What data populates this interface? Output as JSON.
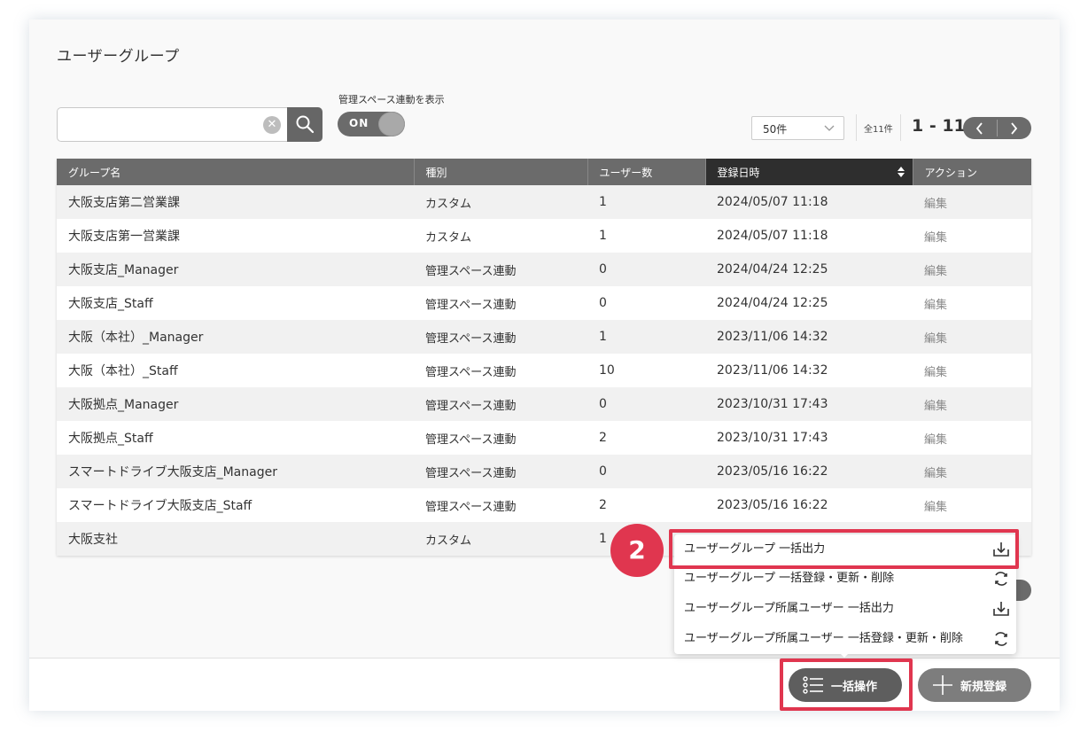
{
  "page": {
    "title": "ユーザーグループ"
  },
  "search": {
    "value": "",
    "placeholder": ""
  },
  "toggle": {
    "label": "管理スペース連動を表示",
    "state": "ON"
  },
  "pagination": {
    "per_page": "50件",
    "total": "全11件",
    "range": "1 - 11"
  },
  "table": {
    "columns": [
      "グループ名",
      "種別",
      "ユーザー数",
      "登録日時",
      "アクション"
    ],
    "rows": [
      {
        "name": "大阪支店第二営業課",
        "type": "カスタム",
        "users": "1",
        "date": "2024/05/07 11:18",
        "action": "編集"
      },
      {
        "name": "大阪支店第一営業課",
        "type": "カスタム",
        "users": "1",
        "date": "2024/05/07 11:18",
        "action": "編集"
      },
      {
        "name": "大阪支店_Manager",
        "type": "管理スペース連動",
        "users": "0",
        "date": "2024/04/24 12:25",
        "action": "編集"
      },
      {
        "name": "大阪支店_Staff",
        "type": "管理スペース連動",
        "users": "0",
        "date": "2024/04/24 12:25",
        "action": "編集"
      },
      {
        "name": "大阪（本社）_Manager",
        "type": "管理スペース連動",
        "users": "1",
        "date": "2023/11/06 14:32",
        "action": "編集"
      },
      {
        "name": "大阪（本社）_Staff",
        "type": "管理スペース連動",
        "users": "10",
        "date": "2023/11/06 14:32",
        "action": "編集"
      },
      {
        "name": "大阪拠点_Manager",
        "type": "管理スペース連動",
        "users": "0",
        "date": "2023/10/31 17:43",
        "action": "編集"
      },
      {
        "name": "大阪拠点_Staff",
        "type": "管理スペース連動",
        "users": "2",
        "date": "2023/10/31 17:43",
        "action": "編集"
      },
      {
        "name": "スマートドライブ大阪支店_Manager",
        "type": "管理スペース連動",
        "users": "0",
        "date": "2023/05/16 16:22",
        "action": "編集"
      },
      {
        "name": "スマートドライブ大阪支店_Staff",
        "type": "管理スペース連動",
        "users": "2",
        "date": "2023/05/16 16:22",
        "action": "編集"
      },
      {
        "name": "大阪支社",
        "type": "カスタム",
        "users": "1",
        "date": "",
        "action": ""
      }
    ]
  },
  "bulk_menu": {
    "items": [
      {
        "label": "ユーザーグループ 一括出力",
        "icon": "download-icon"
      },
      {
        "label": "ユーザーグループ 一括登録・更新・削除",
        "icon": "refresh-icon"
      },
      {
        "label": "ユーザーグループ所属ユーザー 一括出力",
        "icon": "download-icon"
      },
      {
        "label": "ユーザーグループ所属ユーザー 一括登録・更新・削除",
        "icon": "refresh-icon"
      }
    ]
  },
  "annotation": {
    "step": "2"
  },
  "buttons": {
    "bulk": "一括操作",
    "new": "新規登録"
  },
  "colors": {
    "highlight": "#e0364f",
    "header": "#6b6b6b",
    "header_sorted": "#2e2e2e"
  }
}
